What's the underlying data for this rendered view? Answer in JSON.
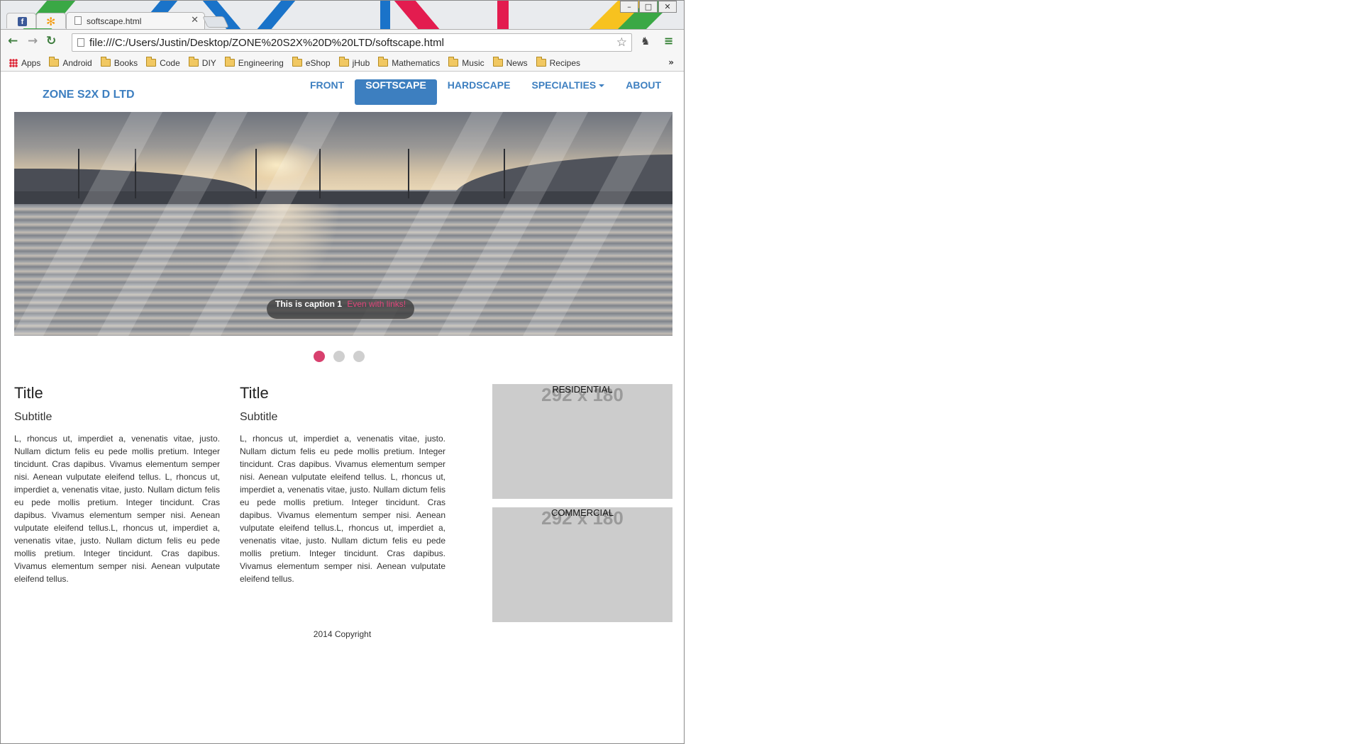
{
  "browser": {
    "tabs": [
      {
        "label": "",
        "icon": "facebook-icon"
      },
      {
        "label": "",
        "icon": "pinwheel-icon"
      },
      {
        "label": "softscape.html",
        "icon": "page-icon"
      }
    ],
    "address": "file:///C:/Users/Justin/Desktop/ZONE%20S2X%20D%20LTD/softscape.html",
    "bookmarks": [
      {
        "label": "Apps",
        "icon": "apps-icon"
      },
      {
        "label": "Android",
        "icon": "folder-icon"
      },
      {
        "label": "Books",
        "icon": "folder-icon"
      },
      {
        "label": "Code",
        "icon": "folder-icon"
      },
      {
        "label": "DIY",
        "icon": "folder-icon"
      },
      {
        "label": "Engineering",
        "icon": "folder-icon"
      },
      {
        "label": "eShop",
        "icon": "folder-icon"
      },
      {
        "label": "jHub",
        "icon": "folder-icon"
      },
      {
        "label": "Mathematics",
        "icon": "folder-icon"
      },
      {
        "label": "Music",
        "icon": "folder-icon"
      },
      {
        "label": "News",
        "icon": "folder-icon"
      },
      {
        "label": "Recipes",
        "icon": "folder-icon"
      }
    ],
    "bookmarks_more": "»"
  },
  "site": {
    "brand": "ZONE S2X D LTD",
    "nav": [
      {
        "label": "FRONT",
        "active": false
      },
      {
        "label": "SOFTSCAPE",
        "active": true
      },
      {
        "label": "HARDSCAPE",
        "active": false
      },
      {
        "label": "SPECIALTIES",
        "active": false,
        "dropdown": true
      },
      {
        "label": "ABOUT",
        "active": false
      }
    ],
    "colors": {
      "brand": "#3d7fc0",
      "active_dot": "#d8406e"
    }
  },
  "carousel": {
    "caption": "This is caption 1",
    "caption_link": "Even with links!",
    "slide_count": 3,
    "active_slide": 1
  },
  "columns": [
    {
      "title": "Title",
      "subtitle": "Subtitle",
      "body": "L, rhoncus ut, imperdiet a, venenatis vitae, justo. Nullam dictum felis eu pede mollis pretium. Integer tincidunt. Cras dapibus. Vivamus elementum semper nisi. Aenean vulputate eleifend tellus. L, rhoncus ut, imperdiet a, venenatis vitae, justo. Nullam dictum felis eu pede mollis pretium. Integer tincidunt. Cras dapibus. Vivamus elementum semper nisi. Aenean vulputate eleifend tellus.L, rhoncus ut, imperdiet a, venenatis vitae, justo. Nullam dictum felis eu pede mollis pretium. Integer tincidunt. Cras dapibus. Vivamus elementum semper nisi. Aenean vulputate eleifend tellus."
    },
    {
      "title": "Title",
      "subtitle": "Subtitle",
      "body": "L, rhoncus ut, imperdiet a, venenatis vitae, justo. Nullam dictum felis eu pede mollis pretium. Integer tincidunt. Cras dapibus. Vivamus elementum semper nisi. Aenean vulputate eleifend tellus. L, rhoncus ut, imperdiet a, venenatis vitae, justo. Nullam dictum felis eu pede mollis pretium. Integer tincidunt. Cras dapibus. Vivamus elementum semper nisi. Aenean vulputate eleifend tellus.L, rhoncus ut, imperdiet a, venenatis vitae, justo. Nullam dictum felis eu pede mollis pretium. Integer tincidunt. Cras dapibus. Vivamus elementum semper nisi. Aenean vulputate eleifend tellus."
    }
  ],
  "tiles": [
    {
      "placeholder": "292 x 180",
      "label": "RESIDENTIAL"
    },
    {
      "placeholder": "292 x 180",
      "label": "COMMERCIAL"
    }
  ],
  "footer": "2014 Copyright"
}
